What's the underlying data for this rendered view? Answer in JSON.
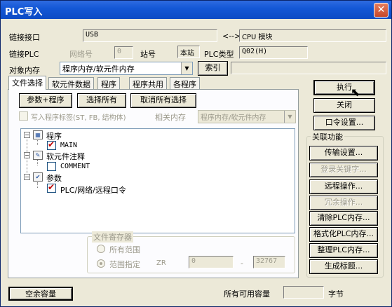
{
  "window": {
    "title": "PLC写入",
    "close": "✕"
  },
  "connection": {
    "link_label": "链接接口",
    "link_value": "USB",
    "arrow": "<-->",
    "cpu_value": "CPU 模块",
    "plc_label": "链接PLC",
    "network_label": "网络号",
    "network_value": "0",
    "station_label": "站号",
    "station_value": "本站",
    "plc_type_label": "PLC类型",
    "plc_type_value": "Q02(H)"
  },
  "target": {
    "label": "对象内存",
    "value": "程序内存/软元件内存",
    "index_button": "索引"
  },
  "tabs": [
    "文件选择",
    "软元件数据",
    "程序",
    "程序共用",
    "各程序"
  ],
  "file_select": {
    "btn_param_program": "参数+程序",
    "btn_select_all": "选择所有",
    "btn_deselect_all": "取消所有选择",
    "write_label_check": "写入程序标签(ST, FB, 结构体)",
    "related_memory_label": "相关内存",
    "related_memory_value": "程序内存/软元件内存"
  },
  "tree": {
    "program": "程序",
    "main": "MAIN",
    "device_comment": "软元件注释",
    "comment": "COMMENT",
    "param": "参数",
    "param_item": "PLC/网络/远程口令"
  },
  "file_register": {
    "title": "文件寄存器",
    "all_range": "所有范围",
    "range_spec": "范围指定",
    "zr": "ZR",
    "from": "0",
    "dash": "-",
    "to": "32767"
  },
  "right_buttons": {
    "execute": "执行",
    "close": "关闭",
    "password": "口令设置...",
    "related_title": "关联功能",
    "transfer": "传输设置...",
    "login_keyword": "登录关键字...",
    "remote_op": "远程操作...",
    "redundant_op": "冗余操作...",
    "clear_plc_memory": "清除PLC内存...",
    "format_plc_memory": "格式化PLC内存...",
    "arrange_plc_memory": "整理PLC内存...",
    "create_title": "生成标题..."
  },
  "footer": {
    "free_capacity_button": "空余容量",
    "all_free_label": "所有可用容量",
    "all_free_value": "",
    "unit": "字节"
  },
  "colors": {
    "titlebar": "#1458d6",
    "check_mark": "#c00000",
    "face": "#ece9d8"
  }
}
